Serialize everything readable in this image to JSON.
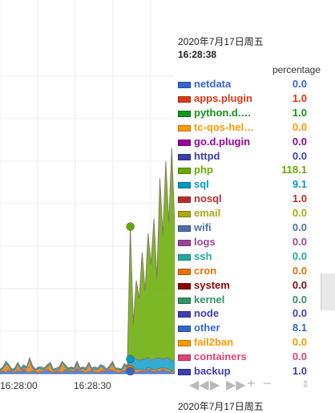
{
  "legend": {
    "date": "2020年7月17日周五",
    "time": "16:28:38",
    "units": "percentage",
    "items": [
      {
        "name": "netdata",
        "value": "0.0",
        "color": "#3366cc"
      },
      {
        "name": "apps.plugin",
        "value": "1.0",
        "color": "#dc3912"
      },
      {
        "name": "python.d.…",
        "value": "1.0",
        "color": "#109618"
      },
      {
        "name": "tc-qos-hel…",
        "value": "0.0",
        "color": "#ff9900"
      },
      {
        "name": "go.d.plugin",
        "value": "0.0",
        "color": "#990099"
      },
      {
        "name": "httpd",
        "value": "0.0",
        "color": "#3b3eac"
      },
      {
        "name": "php",
        "value": "118.1",
        "color": "#66aa00"
      },
      {
        "name": "sql",
        "value": "9.1",
        "color": "#0099c6"
      },
      {
        "name": "nosql",
        "value": "1.0",
        "color": "#b82e2e"
      },
      {
        "name": "email",
        "value": "0.0",
        "color": "#aaaa11"
      },
      {
        "name": "wifi",
        "value": "0.0",
        "color": "#4e6fa6"
      },
      {
        "name": "logs",
        "value": "0.0",
        "color": "#994499"
      },
      {
        "name": "ssh",
        "value": "0.0",
        "color": "#22aa99"
      },
      {
        "name": "cron",
        "value": "0.0",
        "color": "#e67300"
      },
      {
        "name": "system",
        "value": "0.0",
        "color": "#8b0707"
      },
      {
        "name": "kernel",
        "value": "0.0",
        "color": "#329262"
      },
      {
        "name": "node",
        "value": "0.0",
        "color": "#3b3eac"
      },
      {
        "name": "other",
        "value": "8.1",
        "color": "#3366cc"
      },
      {
        "name": "fail2ban",
        "value": "0.0",
        "color": "#ff9900"
      },
      {
        "name": "containers",
        "value": "0.0",
        "color": "#dd4477"
      },
      {
        "name": "backup",
        "value": "1.0",
        "color": "#3b3eac"
      }
    ]
  },
  "chart_data": {
    "type": "area",
    "x_ticks": [
      "16:28:00",
      "16:28:30"
    ],
    "series": [
      {
        "name": "other",
        "values": [
          2,
          3,
          1,
          4,
          2,
          1,
          3,
          2,
          5,
          2,
          1,
          3,
          2,
          1,
          2,
          3,
          4,
          2,
          1,
          3,
          2,
          1,
          4,
          2,
          3,
          2,
          5,
          3,
          2,
          1,
          2,
          3,
          2,
          1,
          2,
          3,
          2,
          4,
          3,
          2,
          1,
          2,
          3,
          4,
          2,
          3,
          1,
          2,
          3,
          2,
          4,
          3,
          2,
          3,
          2,
          4,
          3,
          2,
          1,
          2
        ]
      },
      {
        "name": "cron",
        "values": [
          1,
          2,
          8,
          3,
          1,
          2,
          6,
          2,
          1,
          3,
          12,
          2,
          1,
          4,
          2,
          1,
          3,
          6,
          2,
          1,
          2,
          9,
          3,
          1,
          2,
          2,
          4,
          1,
          3,
          2,
          7,
          1,
          2,
          3,
          5,
          2,
          1,
          2,
          6,
          2,
          3,
          1,
          4,
          2,
          2,
          1,
          3,
          2,
          1,
          1,
          2,
          1,
          2,
          1,
          3,
          1,
          2,
          2,
          1,
          2
        ]
      },
      {
        "name": "sql",
        "values": [
          1,
          1,
          2,
          1,
          1,
          2,
          1,
          1,
          2,
          1,
          1,
          2,
          1,
          1,
          2,
          1,
          1,
          2,
          1,
          1,
          2,
          1,
          1,
          2,
          1,
          1,
          2,
          1,
          1,
          2,
          1,
          1,
          2,
          1,
          1,
          2,
          1,
          1,
          2,
          1,
          1,
          1,
          2,
          1,
          9,
          10,
          9,
          8,
          9,
          10,
          9,
          8,
          9,
          10,
          9,
          8,
          9,
          10,
          9,
          9
        ]
      },
      {
        "name": "php",
        "values": [
          0,
          0,
          0,
          0,
          0,
          0,
          0,
          0,
          0,
          0,
          0,
          0,
          0,
          0,
          0,
          0,
          0,
          0,
          0,
          0,
          0,
          0,
          0,
          0,
          0,
          0,
          0,
          0,
          0,
          0,
          0,
          0,
          0,
          0,
          0,
          0,
          0,
          0,
          0,
          0,
          0,
          0,
          0,
          0,
          118,
          30,
          70,
          55,
          95,
          60,
          110,
          85,
          125,
          70,
          160,
          110,
          175,
          120,
          190,
          118
        ]
      }
    ],
    "grid": true
  }
}
